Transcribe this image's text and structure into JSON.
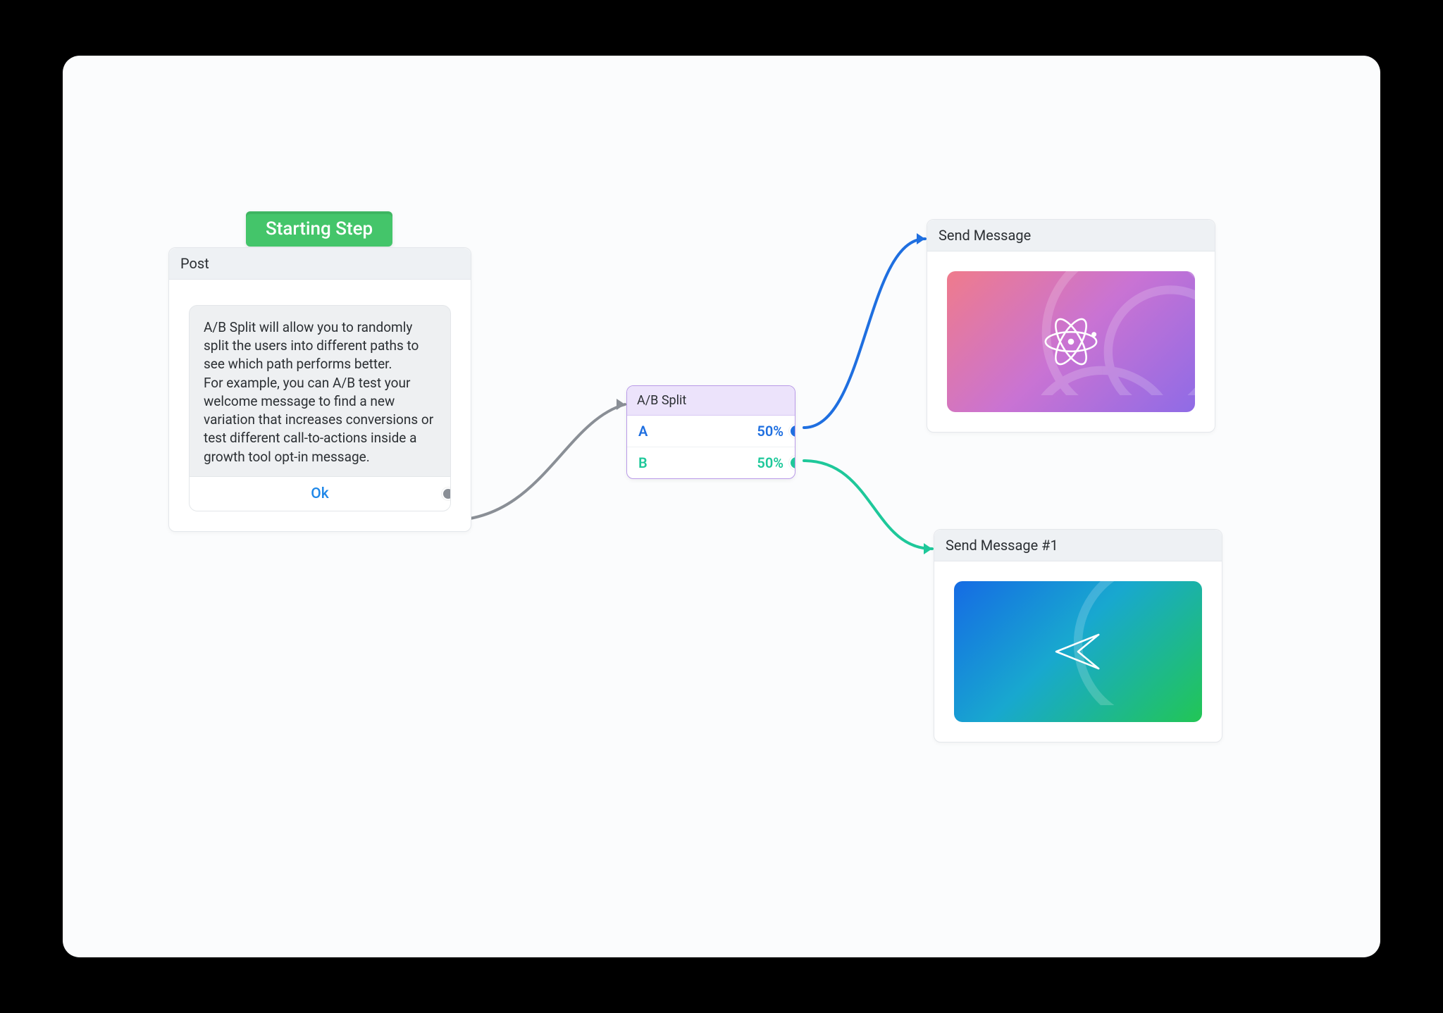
{
  "badge": {
    "label": "Starting Step"
  },
  "post_node": {
    "title": "Post",
    "bubble_text": "A/B Split will allow you to randomly split the users into different paths to see which path performs better.\nFor example, you can A/B test your welcome message to find a new variation that increases conversions or test different call-to-actions inside a growth tool opt-in message.",
    "action_label": "Ok"
  },
  "ab_node": {
    "title": "A/B Split",
    "rows": [
      {
        "label": "A",
        "value": "50%"
      },
      {
        "label": "B",
        "value": "50%"
      }
    ]
  },
  "send_a": {
    "title": "Send Message"
  },
  "send_b": {
    "title": "Send Message #1"
  },
  "colors": {
    "port_grey": "#8a8f96",
    "port_blue": "#1f6fe0",
    "port_green": "#1ec89a"
  }
}
